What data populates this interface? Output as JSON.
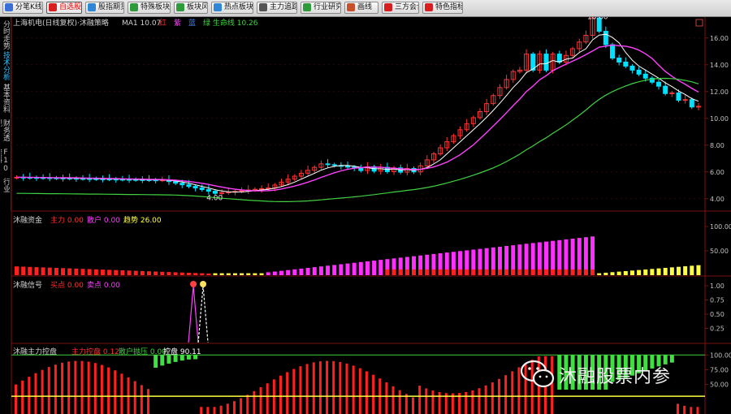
{
  "toolbar": {
    "buttons": [
      {
        "label": "分笔K线",
        "icon": "grid-icon",
        "color": "#3a6fd8"
      },
      {
        "label": "自选股",
        "icon": "heart-icon",
        "color": "#d81e1e",
        "active": true
      },
      {
        "label": "股指期货",
        "icon": "globe-icon",
        "color": "#2f86d6"
      },
      {
        "label": "特殊板块",
        "icon": "chart-icon",
        "color": "#2e9a3a"
      },
      {
        "label": "板块风云",
        "icon": "chart-icon",
        "color": "#2e9a3a"
      },
      {
        "label": "热点板块",
        "icon": "flame-icon",
        "color": "#2f86d6"
      },
      {
        "label": "主力追踪",
        "icon": "track-icon",
        "color": "#555555"
      },
      {
        "label": "行业研究",
        "icon": "check-icon",
        "color": "#2e9a3a"
      },
      {
        "label": "画线",
        "icon": "pen-icon",
        "color": "#c8502a"
      },
      {
        "label": "三方会合",
        "icon": "merge-icon",
        "color": "#d81e1e"
      },
      {
        "label": "特色指标",
        "icon": "indicator-icon",
        "color": "#d81e1e"
      }
    ]
  },
  "sidebar": {
    "tabs": [
      {
        "label": "分时走势",
        "active": false
      },
      {
        "label": "技术分析",
        "active": true
      },
      {
        "label": "基本资料",
        "active": false
      },
      {
        "label": "财务透视",
        "active": false
      },
      {
        "label": "F10资料",
        "active": false
      },
      {
        "label": "行业",
        "active": false
      }
    ]
  },
  "main_panel": {
    "title": "上海机电(日线复权)·沐融策略",
    "ma_label": "MA1 10.07",
    "legend": [
      "红",
      "紫",
      "蓝",
      "绿 生命线 10.26"
    ],
    "legend_colors": [
      "#ff3030",
      "#ff40ff",
      "#4080ff",
      "#40d040"
    ],
    "high_label": "18.60",
    "low_label": "4.00",
    "y_ticks": [
      "16.00",
      "14.00",
      "12.00",
      "10.00",
      "8.00",
      "6.00",
      "4.00"
    ],
    "y_tick_values": [
      16,
      14,
      12,
      10,
      8,
      6,
      4
    ],
    "y_range": [
      3.5,
      17.2
    ]
  },
  "panel2": {
    "title": "沐融资金",
    "fields": [
      "主力 0.00",
      "散户 0.00",
      "趋势 26.00"
    ],
    "field_colors": [
      "#ff3030",
      "#ff40ff",
      "#ffff40"
    ],
    "y_ticks": [
      "100.00",
      "50.00"
    ],
    "y_range": [
      0,
      120
    ]
  },
  "panel3": {
    "title": "沐融信号",
    "fields": [
      "买点 0.00",
      "卖点 0.00"
    ],
    "field_colors": [
      "#ff3030",
      "#ff40ff"
    ],
    "y_ticks": [
      "1.00",
      "0.75",
      "0.50",
      "0.25"
    ],
    "y_range": [
      0,
      1.1
    ]
  },
  "panel4": {
    "title": "沐融主力控盘",
    "fields": [
      "主力控盘 0.12",
      "散户抛压 0.00",
      "控盘 90.11"
    ],
    "field_colors": [
      "#ff3030",
      "#40d040",
      "#ffffff"
    ],
    "y_ticks": [
      "100.00",
      "75.00",
      "50.00"
    ],
    "y_range": [
      0,
      110
    ]
  },
  "watermark": {
    "text": "沐融股票内参"
  },
  "colors": {
    "up": "#ff3333",
    "down": "#00e0ff",
    "grid": "#7a1010",
    "axis_text": "#c0c0c0"
  }
}
